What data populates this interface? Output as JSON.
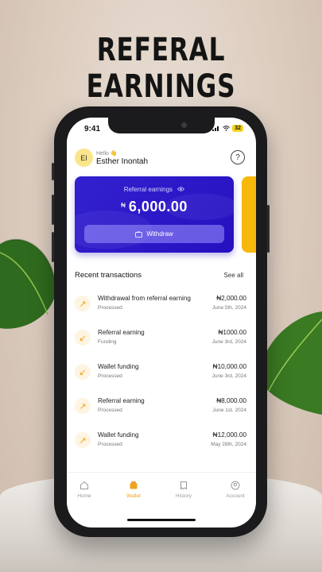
{
  "headline": "REFERAL EARNINGS",
  "status_bar": {
    "time": "9:41",
    "battery": "32"
  },
  "user": {
    "initials": "EI",
    "greeting": "Hello 👋",
    "name": "Esther Inontah"
  },
  "card": {
    "label": "Referral earnings",
    "currency": "₦",
    "amount": "6,000.00",
    "withdraw_label": "Withdraw"
  },
  "transactions_section": {
    "title": "Recent transactions",
    "see_all": "See all"
  },
  "transactions": [
    {
      "title": "Withdrawal from referral earning",
      "status": "Processed",
      "amount": "₦2,000.00",
      "date": "June 5th, 2024",
      "direction": "out"
    },
    {
      "title": "Referral earning",
      "status": "Funding",
      "amount": "₦1000.00",
      "date": "June 3rd, 2024",
      "direction": "in"
    },
    {
      "title": "Wallet funding",
      "status": "Processed",
      "amount": "₦10,000.00",
      "date": "June 3rd, 2024",
      "direction": "in"
    },
    {
      "title": "Referral earning",
      "status": "Processed",
      "amount": "₦8,000.00",
      "date": "June 1st. 2024",
      "direction": "out"
    },
    {
      "title": "Wallet funding",
      "status": "Processed",
      "amount": "₦12,000.00",
      "date": "May 28th, 2024",
      "direction": "out"
    }
  ],
  "nav": {
    "home": "Home",
    "wallet": "Wallet",
    "history": "History",
    "account": "Account",
    "active": "wallet"
  },
  "colors": {
    "card": "#2a16c8",
    "accent": "#f0a320",
    "card_secondary": "#f6b90b"
  }
}
